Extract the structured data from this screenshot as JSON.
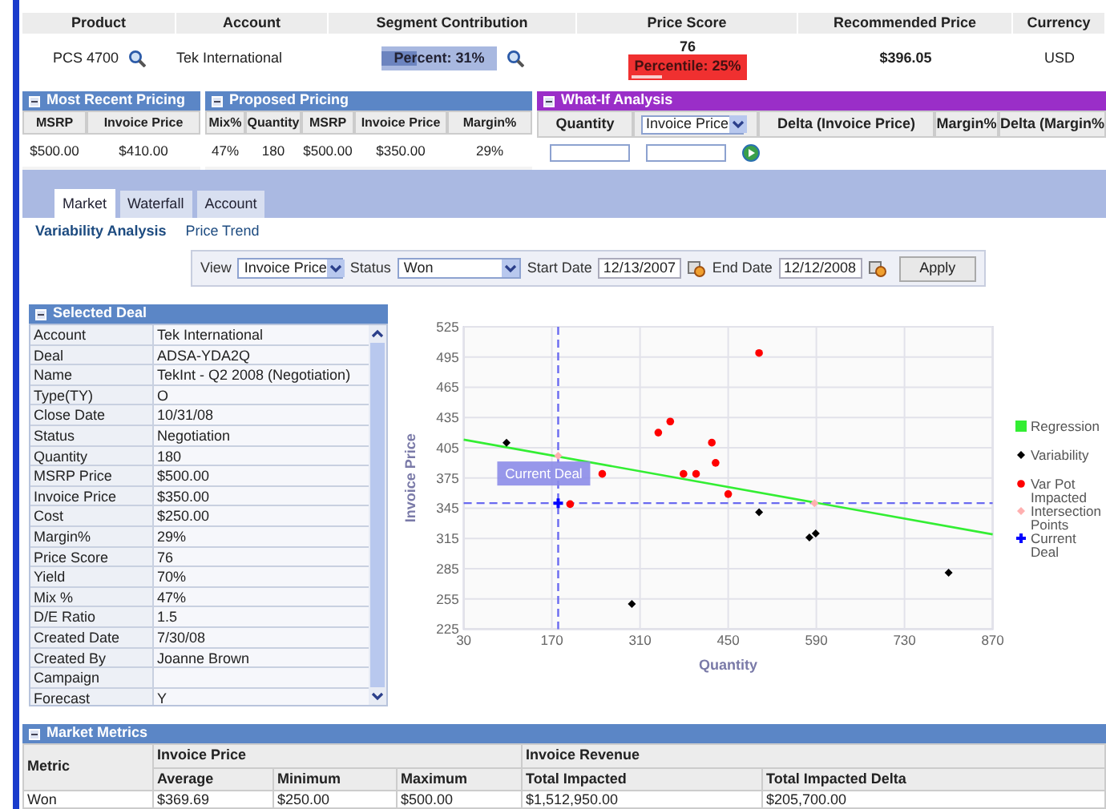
{
  "summary": {
    "columns": [
      "Product",
      "Account",
      "Segment Contribution",
      "Price Score",
      "Recommended Price",
      "Currency"
    ],
    "product": "PCS 4700",
    "account": "Tek International",
    "segment_contribution": {
      "text": "Percent: 31%",
      "level": 0.31
    },
    "price_score": {
      "score": "76",
      "text": "Percentile: 25%",
      "level": 0.25
    },
    "recommended_price": "$396.05",
    "currency": "USD"
  },
  "most_recent_pricing": {
    "title": "Most Recent Pricing",
    "columns": [
      "MSRP",
      "Invoice Price"
    ],
    "row": [
      "$500.00",
      "$410.00"
    ]
  },
  "proposed_pricing": {
    "title": "Proposed Pricing",
    "columns": [
      "Mix%",
      "Quantity",
      "MSRP",
      "Invoice Price",
      "Margin%"
    ],
    "row": [
      "47%",
      "180",
      "$500.00",
      "$350.00",
      "29%"
    ]
  },
  "what_if": {
    "title": "What-If Analysis",
    "columns": [
      {
        "label": "Quantity",
        "kind": "text"
      },
      {
        "label": "Invoice Price",
        "kind": "dropdown"
      },
      {
        "label": "Delta (Invoice Price)",
        "kind": "text"
      },
      {
        "label": "Margin%",
        "kind": "text"
      },
      {
        "label": "Delta (Margin%",
        "kind": "text"
      }
    ]
  },
  "tabs": [
    {
      "label": "Market",
      "selected": true
    },
    {
      "label": "Waterfall",
      "selected": false
    },
    {
      "label": "Account",
      "selected": false
    }
  ],
  "subtabs": [
    {
      "label": "Variability Analysis",
      "selected": true
    },
    {
      "label": "Price Trend",
      "selected": false
    }
  ],
  "filters": [
    {
      "label": "View",
      "value": "Invoice Price",
      "kind": "dropdown"
    },
    {
      "label": "Status",
      "value": "Won",
      "kind": "wide_dropdown"
    },
    {
      "label": "Start Date",
      "value": "12/13/2007",
      "kind": "date"
    },
    {
      "label": "End Date",
      "value": "12/12/2008",
      "kind": "date"
    }
  ],
  "apply_button": "Apply",
  "selected_deal": {
    "title": "Selected Deal",
    "rows": [
      {
        "label": "Account",
        "value": "Tek International"
      },
      {
        "label": "Deal",
        "value": "ADSA-YDA2Q"
      },
      {
        "label": "Name",
        "value": "TekInt - Q2 2008 (Negotiation)"
      },
      {
        "label": "Type(TY)",
        "value": "O"
      },
      {
        "label": "Close Date",
        "value": "10/31/08"
      },
      {
        "label": "Status",
        "value": "Negotiation"
      },
      {
        "label": "Quantity",
        "value": "180"
      },
      {
        "label": "MSRP Price",
        "value": "$500.00"
      },
      {
        "label": "Invoice Price",
        "value": "$350.00"
      },
      {
        "label": "Cost",
        "value": "$250.00"
      },
      {
        "label": "Margin%",
        "value": "29%"
      },
      {
        "label": "Price Score",
        "value": "76"
      },
      {
        "label": "Yield",
        "value": "70%"
      },
      {
        "label": "Mix %",
        "value": "47%"
      },
      {
        "label": "D/E Ratio",
        "value": "1.5"
      },
      {
        "label": "Created Date",
        "value": "7/30/08"
      },
      {
        "label": "Created By",
        "value": "Joanne Brown"
      },
      {
        "label": "Campaign",
        "value": ""
      },
      {
        "label": "Forecast",
        "value": "Y"
      }
    ]
  },
  "chart": {
    "chart_data": {
      "type": "scatter",
      "xlabel": "Quantity",
      "ylabel": "Invoice Price",
      "xlim": [
        30,
        870
      ],
      "ylim": [
        225,
        525
      ],
      "xticks": [
        30,
        170,
        310,
        450,
        590,
        730,
        870
      ],
      "yticks": [
        225,
        255,
        285,
        315,
        345,
        375,
        405,
        435,
        465,
        495,
        525
      ],
      "x": [
        30,
        98,
        180,
        199,
        250,
        297,
        339,
        358,
        379,
        399,
        424,
        430,
        450,
        499,
        579,
        587,
        589,
        800,
        870
      ],
      "series": [
        {
          "name": "Regression",
          "type": "line",
          "color": "#33ee33",
          "values": [
            413,
            null,
            null,
            null,
            null,
            null,
            null,
            null,
            null,
            null,
            null,
            null,
            null,
            null,
            null,
            null,
            null,
            null,
            319
          ]
        },
        {
          "name": "Variability",
          "color": "#000000",
          "values": [
            null,
            410,
            null,
            null,
            null,
            250,
            null,
            null,
            null,
            null,
            null,
            null,
            null,
            341,
            316,
            null,
            320,
            281,
            null
          ]
        },
        {
          "name": "Var Pot Impacted",
          "color": "#ff0000",
          "values": [
            null,
            null,
            null,
            349,
            379,
            null,
            420,
            431,
            379,
            379,
            410,
            390,
            359,
            499,
            null,
            null,
            null,
            null,
            null
          ]
        },
        {
          "name": "Intersection Points",
          "color": "#ffb0b0",
          "values": [
            null,
            null,
            397,
            null,
            null,
            null,
            null,
            null,
            null,
            null,
            null,
            null,
            null,
            null,
            null,
            350,
            null,
            null,
            null
          ]
        },
        {
          "name": "Current Deal",
          "color": "#0000ff",
          "values": [
            null,
            null,
            350,
            null,
            null,
            null,
            null,
            null,
            null,
            null,
            null,
            null,
            null,
            null,
            null,
            null,
            null,
            null,
            null
          ]
        }
      ],
      "annotations": [
        "Current Deal"
      ],
      "grid": true,
      "legend": true,
      "ref_lines": [
        {
          "axis": "x",
          "value": 180
        },
        {
          "axis": "y",
          "value": 350
        }
      ]
    }
  },
  "market_metrics": {
    "title": "Market Metrics",
    "metric_header": "Metric",
    "groups": [
      {
        "label": "Invoice Price",
        "columns": [
          "Average",
          "Minimum",
          "Maximum"
        ]
      },
      {
        "label": "Invoice Revenue",
        "columns": [
          "Total Impacted",
          "Total Impacted Delta"
        ]
      }
    ],
    "rows": [
      {
        "metric": "Won",
        "values": [
          "$369.69",
          "$250.00",
          "$500.00",
          "$1,512,950.00",
          "$205,700.00"
        ]
      }
    ]
  }
}
